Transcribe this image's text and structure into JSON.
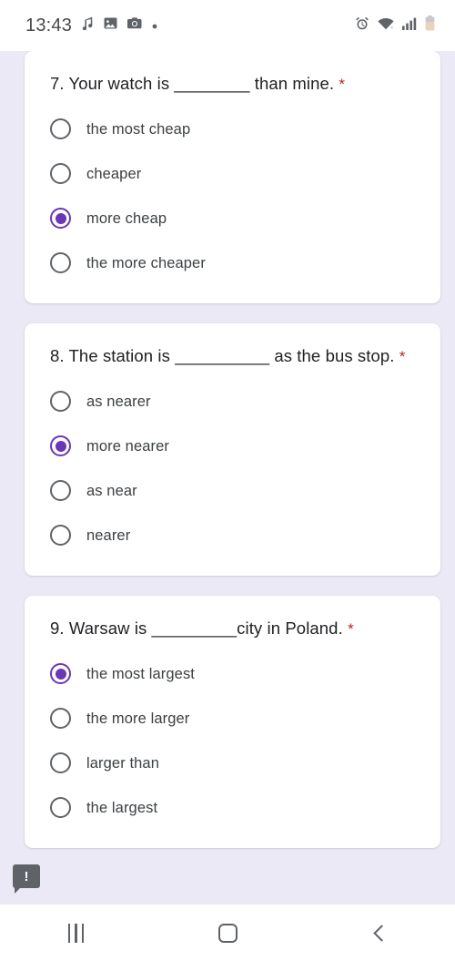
{
  "status_bar": {
    "time": "13:43",
    "left_icons": [
      "music-note-icon",
      "gallery-icon",
      "camera-icon",
      "dot-icon"
    ],
    "right_icons": [
      "alarm-icon",
      "wifi-icon",
      "signal-icon",
      "battery-icon"
    ]
  },
  "form": {
    "required_marker": "*",
    "questions": [
      {
        "text": "7. Your watch is ________ than mine.",
        "required": true,
        "options": [
          {
            "label": "the most cheap",
            "selected": false
          },
          {
            "label": "cheaper",
            "selected": false
          },
          {
            "label": "more cheap",
            "selected": true
          },
          {
            "label": "the more cheaper",
            "selected": false
          }
        ]
      },
      {
        "text": "8. The station is __________ as the bus stop.",
        "required": true,
        "options": [
          {
            "label": "as nearer",
            "selected": false
          },
          {
            "label": "more nearer",
            "selected": true
          },
          {
            "label": "as near",
            "selected": false
          },
          {
            "label": "nearer",
            "selected": false
          }
        ]
      },
      {
        "text": "9. Warsaw is _________city in Poland.",
        "required": true,
        "options": [
          {
            "label": "the most largest",
            "selected": true
          },
          {
            "label": "the more larger",
            "selected": false
          },
          {
            "label": "larger than",
            "selected": false
          },
          {
            "label": "the largest",
            "selected": false
          }
        ]
      }
    ]
  },
  "toast": {
    "icon": "alert-bubble-icon",
    "symbol": "!"
  },
  "nav_bar": {
    "recents_label": "recents-icon",
    "home_label": "home-icon",
    "back_label": "back-icon"
  },
  "colors": {
    "accent": "#6A37B5",
    "page_background": "#EBE9F5",
    "card": "#FFFFFF",
    "required": "#B3261E",
    "text": "#202124"
  }
}
